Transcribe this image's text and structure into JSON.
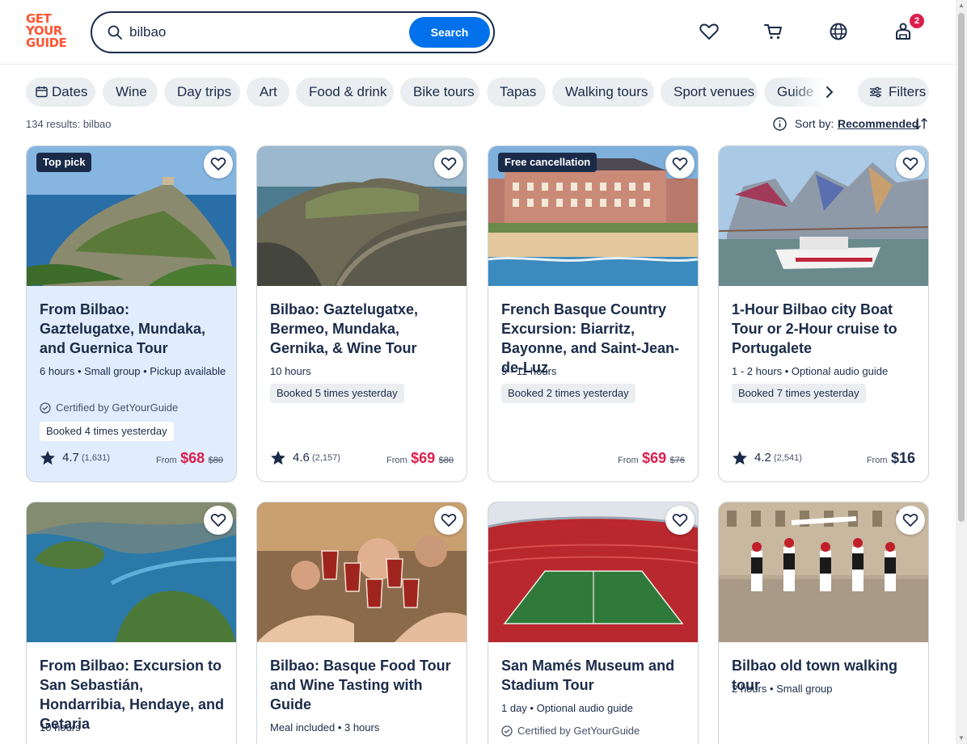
{
  "header": {
    "logo_lines": [
      "GET",
      "YOUR",
      "GUIDE"
    ],
    "search_value": "bilbao",
    "search_button": "Search",
    "cart_count": "2"
  },
  "chips": [
    "Dates",
    "Wine",
    "Day trips",
    "Art",
    "Food & drink",
    "Bike tours",
    "Tapas",
    "Walking tours",
    "Sport venues",
    "Guide"
  ],
  "filters_label": "Filters",
  "results_text": "134 results: bilbao",
  "sort": {
    "label": "Sort by:",
    "value": "Recommended"
  },
  "cards": [
    {
      "tag": "Top pick",
      "title": "From Bilbao: Gaztelugatxe, Mundaka, and Guernica Tour",
      "meta": "6 hours • Small group • Pickup available",
      "certified": "Certified by GetYourGuide",
      "booked": "Booked 4 times yesterday",
      "rating": "4.7",
      "reviews": "(1,631)",
      "from": "From",
      "price": "$68",
      "original_price": "$80"
    },
    {
      "tag": "",
      "title": "Bilbao: Gaztelugatxe, Bermeo, Mundaka, Gernika, & Wine Tour",
      "meta": "10 hours",
      "booked": "Booked 5 times yesterday",
      "rating": "4.6",
      "reviews": "(2,157)",
      "from": "From",
      "price": "$69",
      "original_price": "$80"
    },
    {
      "tag": "Free cancellation",
      "title": "French Basque Country Excursion: Biarritz, Bayonne, and Saint-Jean-de-Luz",
      "meta": "9 - 11 hours",
      "booked": "Booked 2 times yesterday",
      "from": "From",
      "price": "$69",
      "original_price": "$76"
    },
    {
      "tag": "",
      "title": "1-Hour Bilbao city Boat Tour or 2-Hour cruise to Portugalete",
      "meta": "1 - 2 hours • Optional audio guide",
      "booked": "Booked 7 times yesterday",
      "rating": "4.2",
      "reviews": "(2,541)",
      "from": "From",
      "price": "$16"
    },
    {
      "title": "From Bilbao: Excursion to San Sebastián, Hondarribia, Hendaye, and Getaria",
      "meta": "10 hours"
    },
    {
      "title": "Bilbao: Basque Food Tour and Wine Tasting with Guide",
      "meta": "Meal included • 3 hours"
    },
    {
      "title": "San Mamés Museum and Stadium Tour",
      "meta": "1 day • Optional audio guide",
      "certified": "Certified by GetYourGuide"
    },
    {
      "title": "Bilbao old town walking tour",
      "meta": "2 hours • Small group"
    }
  ],
  "icons": {
    "wishlist": "heart-icon",
    "cart": "cart-icon",
    "language": "globe-icon",
    "profile": "profile-icon",
    "search": "search-icon",
    "calendar": "calendar-icon",
    "filters": "sliders-icon",
    "sort": "sort-arrows-icon",
    "info": "info-icon",
    "star": "star-icon",
    "certified": "check-badge-icon"
  },
  "colors": {
    "brand": "#ff5533",
    "primary": "#0071eb",
    "text": "#1a2b49",
    "sale": "#dc1e4c",
    "highlight_card": "#e1ecfc",
    "chip_bg": "#ebeef1"
  }
}
